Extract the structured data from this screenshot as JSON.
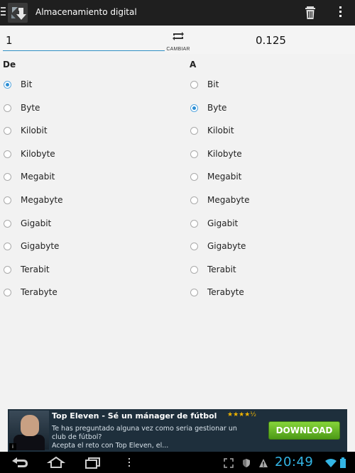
{
  "app": {
    "title": "Almacenamiento digital"
  },
  "converter": {
    "from_value": "1",
    "swap_label": "CAMBIAR",
    "to_value": "0.125"
  },
  "from_column": {
    "header": "De",
    "units": [
      {
        "label": "Bit",
        "selected": true
      },
      {
        "label": "Byte",
        "selected": false
      },
      {
        "label": "Kilobit",
        "selected": false
      },
      {
        "label": "Kilobyte",
        "selected": false
      },
      {
        "label": "Megabit",
        "selected": false
      },
      {
        "label": "Megabyte",
        "selected": false
      },
      {
        "label": "Gigabit",
        "selected": false
      },
      {
        "label": "Gigabyte",
        "selected": false
      },
      {
        "label": "Terabit",
        "selected": false
      },
      {
        "label": "Terabyte",
        "selected": false
      }
    ]
  },
  "to_column": {
    "header": "A",
    "units": [
      {
        "label": "Bit",
        "selected": false
      },
      {
        "label": "Byte",
        "selected": true
      },
      {
        "label": "Kilobit",
        "selected": false
      },
      {
        "label": "Kilobyte",
        "selected": false
      },
      {
        "label": "Megabit",
        "selected": false
      },
      {
        "label": "Megabyte",
        "selected": false
      },
      {
        "label": "Gigabit",
        "selected": false
      },
      {
        "label": "Gigabyte",
        "selected": false
      },
      {
        "label": "Terabit",
        "selected": false
      },
      {
        "label": "Terabyte",
        "selected": false
      }
    ]
  },
  "ad": {
    "title": "Top Eleven - Sé un mánager de fútbol",
    "rating_stars": "★★★★½",
    "body_line1": "Te has preguntado alguna vez como seria gestionar un",
    "body_line2": "club de fútbol?",
    "body_line3": "Acepta el reto con Top Eleven, el...",
    "button_label": "DOWNLOAD",
    "badge": "i"
  },
  "system_bar": {
    "clock": "20:49"
  },
  "colors": {
    "accent": "#33b5e5",
    "radio_selected": "#2a8dd4",
    "actionbar": "#1f1f1f"
  }
}
